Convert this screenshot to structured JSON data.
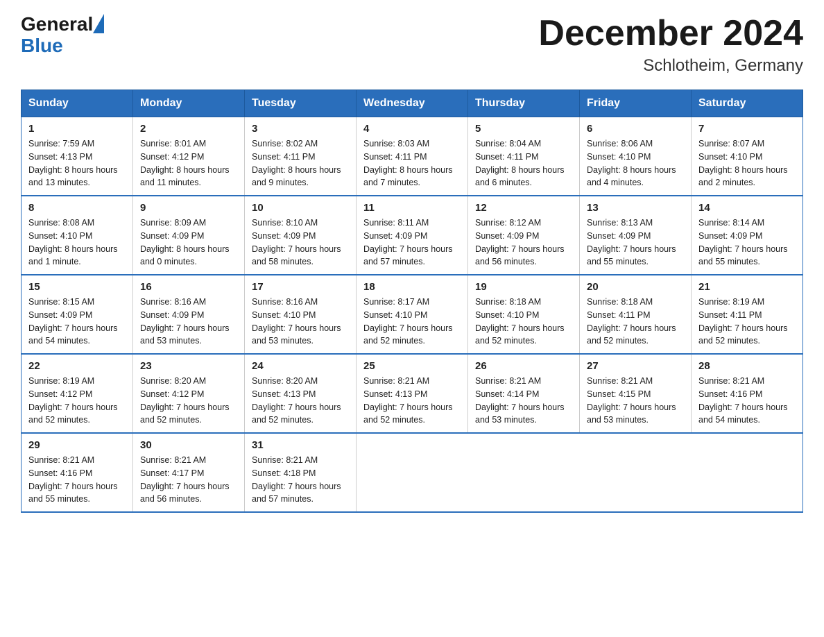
{
  "header": {
    "logo_general": "General",
    "logo_blue": "Blue",
    "month_title": "December 2024",
    "location": "Schlotheim, Germany"
  },
  "days_of_week": [
    "Sunday",
    "Monday",
    "Tuesday",
    "Wednesday",
    "Thursday",
    "Friday",
    "Saturday"
  ],
  "weeks": [
    [
      {
        "day": "1",
        "sunrise": "7:59 AM",
        "sunset": "4:13 PM",
        "daylight": "8 hours and 13 minutes."
      },
      {
        "day": "2",
        "sunrise": "8:01 AM",
        "sunset": "4:12 PM",
        "daylight": "8 hours and 11 minutes."
      },
      {
        "day": "3",
        "sunrise": "8:02 AM",
        "sunset": "4:11 PM",
        "daylight": "8 hours and 9 minutes."
      },
      {
        "day": "4",
        "sunrise": "8:03 AM",
        "sunset": "4:11 PM",
        "daylight": "8 hours and 7 minutes."
      },
      {
        "day": "5",
        "sunrise": "8:04 AM",
        "sunset": "4:11 PM",
        "daylight": "8 hours and 6 minutes."
      },
      {
        "day": "6",
        "sunrise": "8:06 AM",
        "sunset": "4:10 PM",
        "daylight": "8 hours and 4 minutes."
      },
      {
        "day": "7",
        "sunrise": "8:07 AM",
        "sunset": "4:10 PM",
        "daylight": "8 hours and 2 minutes."
      }
    ],
    [
      {
        "day": "8",
        "sunrise": "8:08 AM",
        "sunset": "4:10 PM",
        "daylight": "8 hours and 1 minute."
      },
      {
        "day": "9",
        "sunrise": "8:09 AM",
        "sunset": "4:09 PM",
        "daylight": "8 hours and 0 minutes."
      },
      {
        "day": "10",
        "sunrise": "8:10 AM",
        "sunset": "4:09 PM",
        "daylight": "7 hours and 58 minutes."
      },
      {
        "day": "11",
        "sunrise": "8:11 AM",
        "sunset": "4:09 PM",
        "daylight": "7 hours and 57 minutes."
      },
      {
        "day": "12",
        "sunrise": "8:12 AM",
        "sunset": "4:09 PM",
        "daylight": "7 hours and 56 minutes."
      },
      {
        "day": "13",
        "sunrise": "8:13 AM",
        "sunset": "4:09 PM",
        "daylight": "7 hours and 55 minutes."
      },
      {
        "day": "14",
        "sunrise": "8:14 AM",
        "sunset": "4:09 PM",
        "daylight": "7 hours and 55 minutes."
      }
    ],
    [
      {
        "day": "15",
        "sunrise": "8:15 AM",
        "sunset": "4:09 PM",
        "daylight": "7 hours and 54 minutes."
      },
      {
        "day": "16",
        "sunrise": "8:16 AM",
        "sunset": "4:09 PM",
        "daylight": "7 hours and 53 minutes."
      },
      {
        "day": "17",
        "sunrise": "8:16 AM",
        "sunset": "4:10 PM",
        "daylight": "7 hours and 53 minutes."
      },
      {
        "day": "18",
        "sunrise": "8:17 AM",
        "sunset": "4:10 PM",
        "daylight": "7 hours and 52 minutes."
      },
      {
        "day": "19",
        "sunrise": "8:18 AM",
        "sunset": "4:10 PM",
        "daylight": "7 hours and 52 minutes."
      },
      {
        "day": "20",
        "sunrise": "8:18 AM",
        "sunset": "4:11 PM",
        "daylight": "7 hours and 52 minutes."
      },
      {
        "day": "21",
        "sunrise": "8:19 AM",
        "sunset": "4:11 PM",
        "daylight": "7 hours and 52 minutes."
      }
    ],
    [
      {
        "day": "22",
        "sunrise": "8:19 AM",
        "sunset": "4:12 PM",
        "daylight": "7 hours and 52 minutes."
      },
      {
        "day": "23",
        "sunrise": "8:20 AM",
        "sunset": "4:12 PM",
        "daylight": "7 hours and 52 minutes."
      },
      {
        "day": "24",
        "sunrise": "8:20 AM",
        "sunset": "4:13 PM",
        "daylight": "7 hours and 52 minutes."
      },
      {
        "day": "25",
        "sunrise": "8:21 AM",
        "sunset": "4:13 PM",
        "daylight": "7 hours and 52 minutes."
      },
      {
        "day": "26",
        "sunrise": "8:21 AM",
        "sunset": "4:14 PM",
        "daylight": "7 hours and 53 minutes."
      },
      {
        "day": "27",
        "sunrise": "8:21 AM",
        "sunset": "4:15 PM",
        "daylight": "7 hours and 53 minutes."
      },
      {
        "day": "28",
        "sunrise": "8:21 AM",
        "sunset": "4:16 PM",
        "daylight": "7 hours and 54 minutes."
      }
    ],
    [
      {
        "day": "29",
        "sunrise": "8:21 AM",
        "sunset": "4:16 PM",
        "daylight": "7 hours and 55 minutes."
      },
      {
        "day": "30",
        "sunrise": "8:21 AM",
        "sunset": "4:17 PM",
        "daylight": "7 hours and 56 minutes."
      },
      {
        "day": "31",
        "sunrise": "8:21 AM",
        "sunset": "4:18 PM",
        "daylight": "7 hours and 57 minutes."
      },
      null,
      null,
      null,
      null
    ]
  ],
  "labels": {
    "sunrise": "Sunrise:",
    "sunset": "Sunset:",
    "daylight": "Daylight:"
  }
}
